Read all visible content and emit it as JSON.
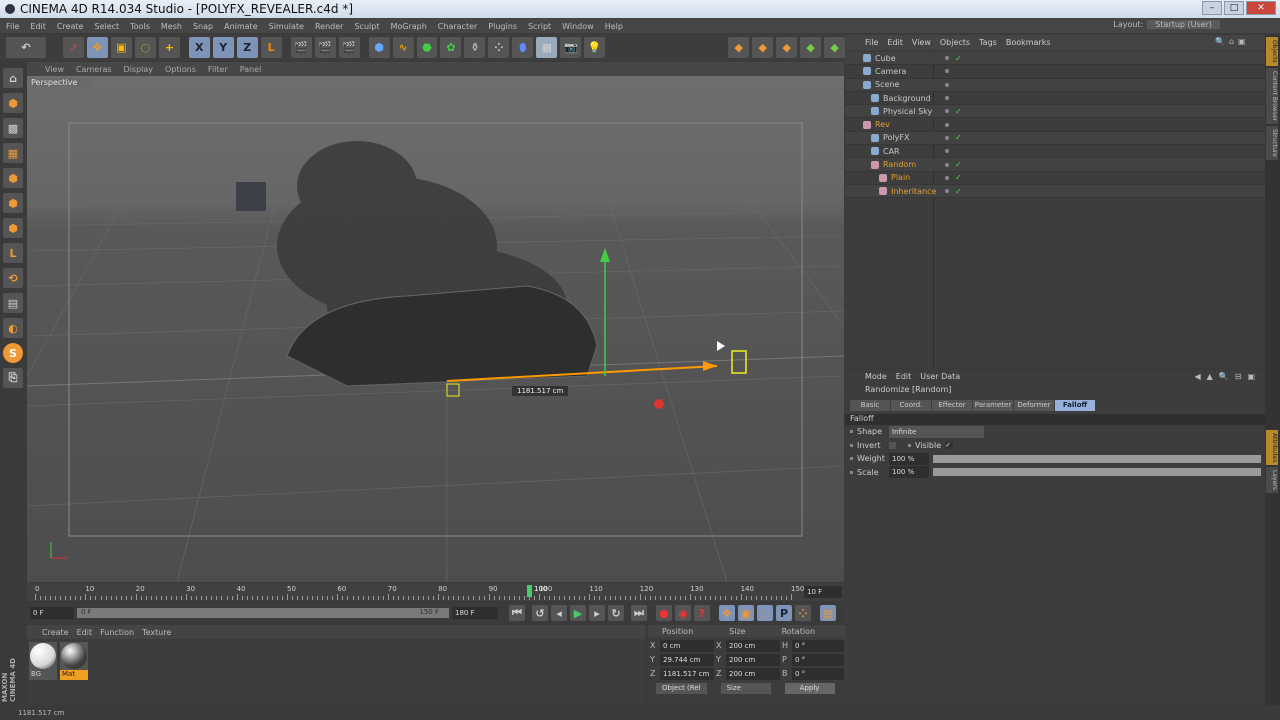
{
  "window": {
    "title": "CINEMA 4D R14.034 Studio - [POLYFX_REVEALER.c4d *]"
  },
  "menu": [
    "File",
    "Edit",
    "Create",
    "Select",
    "Tools",
    "Mesh",
    "Snap",
    "Animate",
    "Simulate",
    "Render",
    "Sculpt",
    "MoGraph",
    "Character",
    "Plugins",
    "Script",
    "Window",
    "Help"
  ],
  "layout": {
    "label": "Layout:",
    "value": "Startup (User)"
  },
  "toolbar": {
    "x": "X",
    "y": "Y",
    "z": "Z"
  },
  "viewport": {
    "menu": [
      "View",
      "Cameras",
      "Display",
      "Options",
      "Filter",
      "Panel"
    ],
    "label": "Perspective",
    "hud": "1181.517 cm"
  },
  "timeline": {
    "ticks": [
      "0",
      "10",
      "20",
      "30",
      "40",
      "50",
      "60",
      "70",
      "80",
      "90",
      "100",
      "110",
      "120",
      "130",
      "140",
      "150"
    ],
    "current": "100",
    "end_field": "10 F",
    "start": "0 F",
    "range_start": "0 F",
    "range_end": "150 F",
    "max": "180 F"
  },
  "materials": {
    "menu": [
      "Create",
      "Edit",
      "Function",
      "Texture"
    ],
    "items": [
      {
        "name": "BG",
        "color": "#d8d8d8",
        "selected": false
      },
      {
        "name": "Mat",
        "color": "#444",
        "selected": true
      }
    ]
  },
  "coords": {
    "headers": [
      "Position",
      "Size",
      "Rotation"
    ],
    "rows": [
      {
        "axis": "X",
        "pos": "0 cm",
        "saxis": "X",
        "size": "200 cm",
        "raxis": "H",
        "rot": "0 °"
      },
      {
        "axis": "Y",
        "pos": "29.744 cm",
        "saxis": "Y",
        "size": "200 cm",
        "raxis": "P",
        "rot": "0 °"
      },
      {
        "axis": "Z",
        "pos": "1181.517 cm",
        "saxis": "Z",
        "size": "200 cm",
        "raxis": "B",
        "rot": "0 °"
      }
    ],
    "mode": "Object (Rel",
    "size_mode": "Size",
    "apply": "Apply"
  },
  "status": "1181.517 cm",
  "brand": "MAXON CINEMA 4D",
  "objects": {
    "menu": [
      "File",
      "Edit",
      "View",
      "Objects",
      "Tags",
      "Bookmarks"
    ],
    "items": [
      {
        "name": "Cube",
        "indent": 0,
        "orange": false,
        "check": true
      },
      {
        "name": "Camera",
        "indent": 0,
        "orange": false,
        "check": false
      },
      {
        "name": "Scene",
        "indent": 0,
        "orange": false,
        "check": false
      },
      {
        "name": "Background",
        "indent": 1,
        "orange": false,
        "check": false
      },
      {
        "name": "Physical Sky",
        "indent": 1,
        "orange": false,
        "check": true
      },
      {
        "name": "Rev",
        "indent": 0,
        "orange": true,
        "check": false
      },
      {
        "name": "PolyFX",
        "indent": 1,
        "orange": false,
        "check": true
      },
      {
        "name": "CAR",
        "indent": 1,
        "orange": false,
        "check": false
      },
      {
        "name": "Random",
        "indent": 1,
        "orange": true,
        "check": true
      },
      {
        "name": "Plain",
        "indent": 2,
        "orange": true,
        "check": true
      },
      {
        "name": "Inheritance",
        "indent": 2,
        "orange": true,
        "check": true
      }
    ]
  },
  "attributes": {
    "menu": [
      "Mode",
      "Edit",
      "User Data"
    ],
    "title": "Randomize [Random]",
    "tabs": [
      "Basic",
      "Coord.",
      "Effector",
      "Parameter",
      "Deformer",
      "Falloff"
    ],
    "active_tab": "Falloff",
    "section": "Falloff",
    "shape_label": "Shape",
    "shape_value": "Infinite",
    "invert_label": "Invert",
    "visible_label": "Visible",
    "weight_label": "Weight",
    "weight_value": "100 %",
    "weight": 1.0,
    "scale_label": "Scale",
    "scale_value": "100 %",
    "scale": 1.0
  },
  "sidetabs": [
    "Objects",
    "Content Browser",
    "Structure",
    "Attributes",
    "Layers"
  ]
}
